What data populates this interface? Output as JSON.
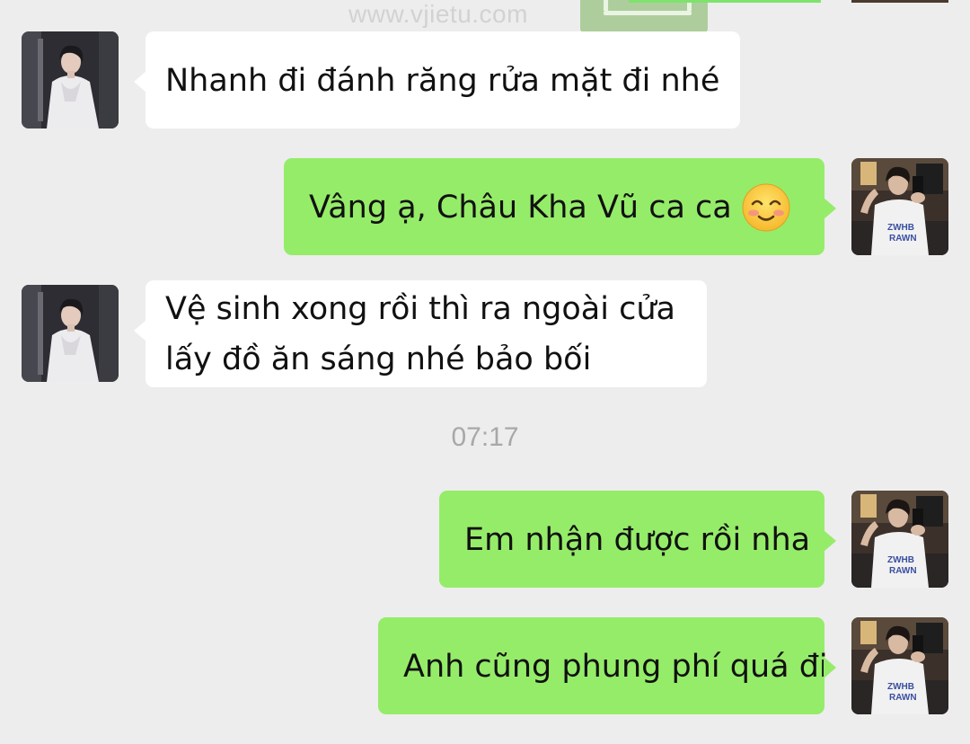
{
  "watermark": "www.vjietu.com",
  "messages": [
    {
      "side": "left",
      "text": "Nhanh đi đánh răng rửa mặt đi nhé"
    },
    {
      "side": "right",
      "text": "Vâng ạ, Châu Kha Vũ ca ca",
      "emoji": "smiling-face-icon"
    },
    {
      "side": "left",
      "lines": [
        "Vệ sinh xong rồi thì ra ngoài cửa",
        "lấy đồ ăn sáng nhé bảo bối"
      ]
    },
    {
      "side": "right",
      "text": "Em nhận được rồi nha"
    },
    {
      "side": "right",
      "text": "Anh cũng phung phí quá đi"
    }
  ],
  "timestamp": "07:17",
  "colors": {
    "background": "#ededed",
    "incoming_bubble": "#ffffff",
    "outgoing_bubble": "#95ec69",
    "timestamp_text": "#a8a8a8"
  }
}
